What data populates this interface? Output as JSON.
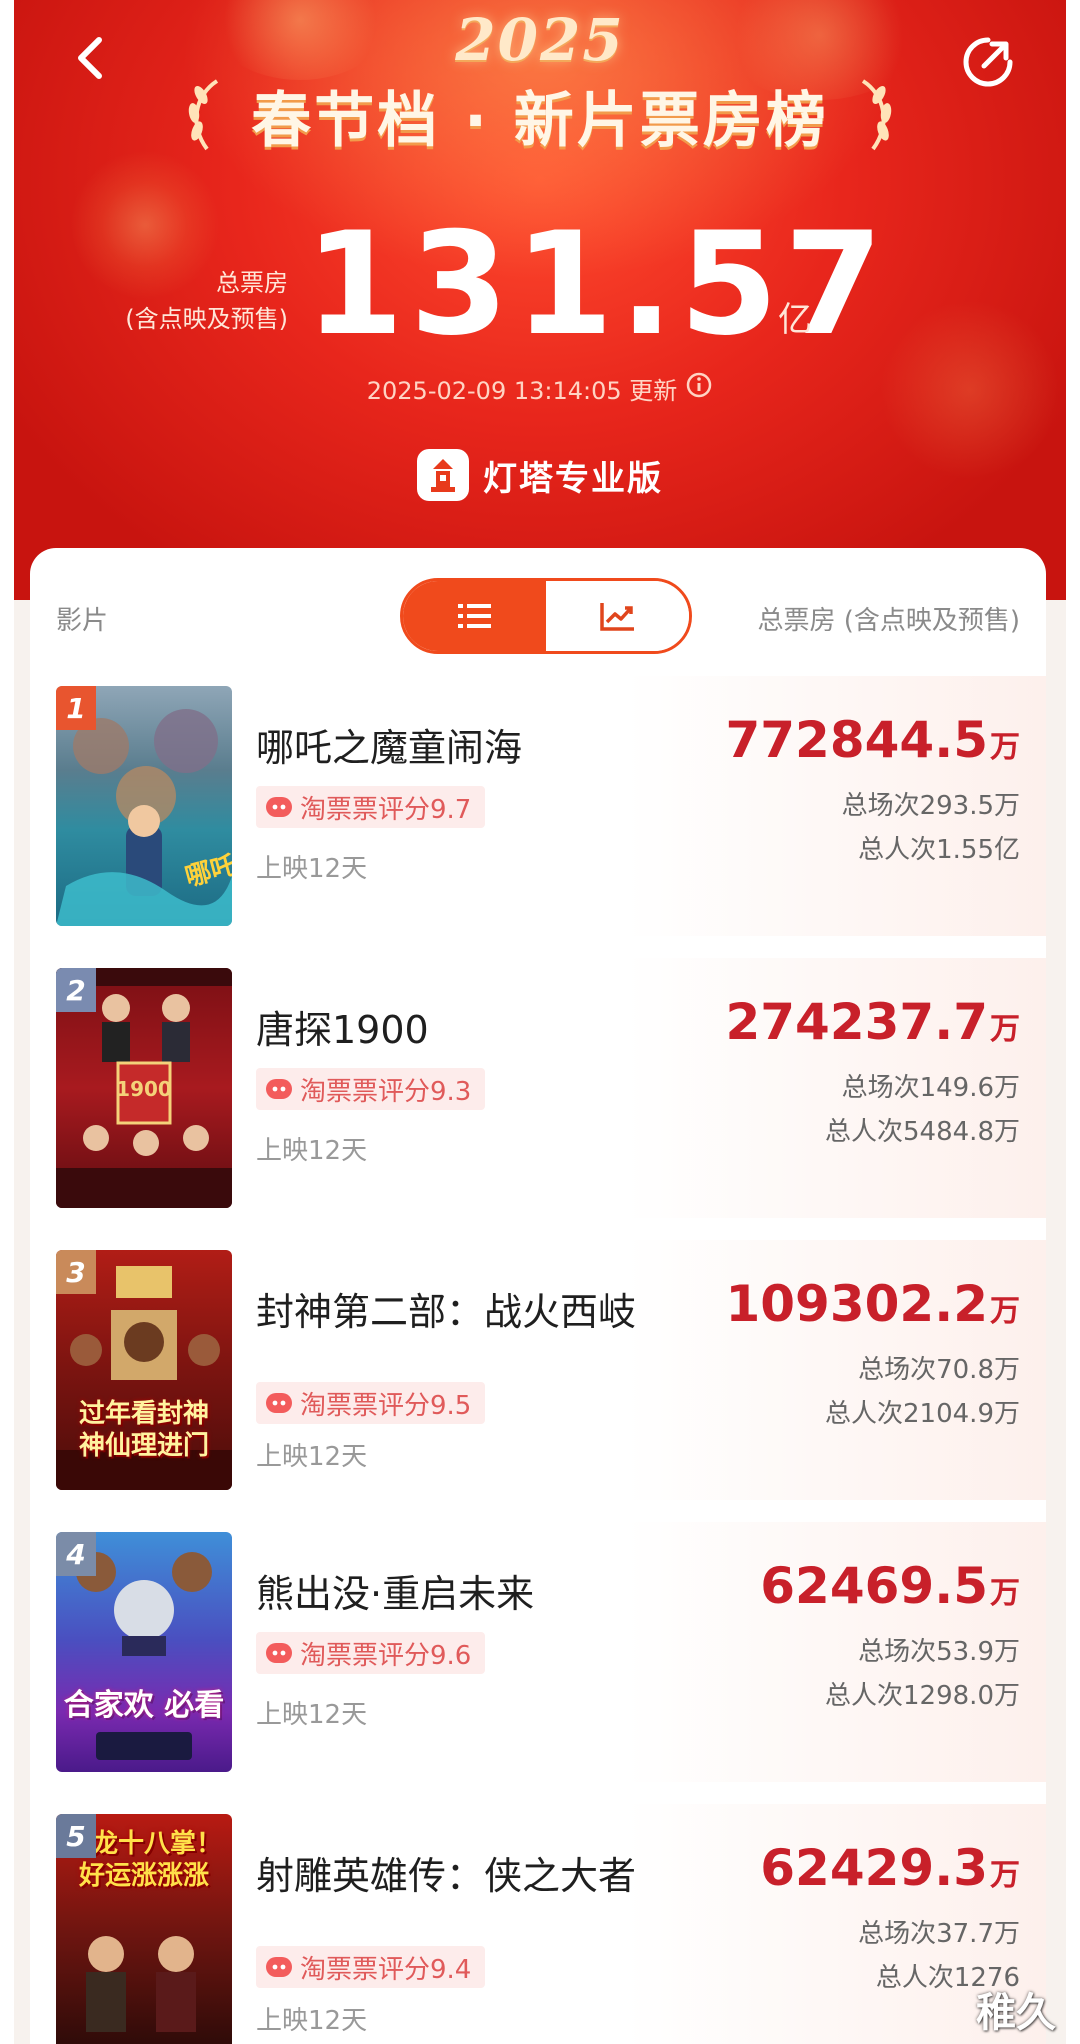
{
  "header": {
    "year": "2025",
    "title": "春节档 · 新片票房榜",
    "total_label_line1": "总票房",
    "total_label_line2": "(含点映及预售)",
    "total_value": "131.57",
    "total_unit": "亿",
    "update_time": "2025-02-09 13:14:05 更新",
    "brand": "灯塔专业版"
  },
  "table_header": {
    "film_col": "影片",
    "total_col": "总票房 (含点映及预售)",
    "view_toggle": [
      "list-icon",
      "chart-icon"
    ],
    "active_view": "list"
  },
  "movies": [
    {
      "rank": "1",
      "title": "哪吒之魔童闹海",
      "rating": "淘票票评分9.7",
      "days": "上映12天",
      "gross": "772844.5",
      "unit": "万",
      "screenings": "总场次293.5万",
      "admissions": "总人次1.55亿"
    },
    {
      "rank": "2",
      "title": "唐探1900",
      "rating": "淘票票评分9.3",
      "days": "上映12天",
      "gross": "274237.7",
      "unit": "万",
      "screenings": "总场次149.6万",
      "admissions": "总人次5484.8万"
    },
    {
      "rank": "3",
      "title": "封神第二部：战火西岐",
      "rating": "淘票票评分9.5",
      "days": "上映12天",
      "gross": "109302.2",
      "unit": "万",
      "screenings": "总场次70.8万",
      "admissions": "总人次2104.9万",
      "poster_text": "过年看封神 神仙理进门"
    },
    {
      "rank": "4",
      "title": "熊出没·重启未来",
      "rating": "淘票票评分9.6",
      "days": "上映12天",
      "gross": "62469.5",
      "unit": "万",
      "screenings": "总场次53.9万",
      "admissions": "总人次1298.0万",
      "poster_text": "合家欢 必看"
    },
    {
      "rank": "5",
      "title": "射雕英雄传：侠之大者",
      "rating": "淘票票评分9.4",
      "days": "上映12天",
      "gross": "62429.3",
      "unit": "万",
      "screenings": "总场次37.7万",
      "admissions": "总人次1276",
      "poster_text": "降龙十八掌！好运涨涨涨"
    }
  ],
  "watermark": "稚久",
  "colors": {
    "header_red": "#d41a12",
    "accent_orange": "#f04a1c",
    "gross_red": "#c8202a",
    "rating_bg": "#fdeceb"
  }
}
